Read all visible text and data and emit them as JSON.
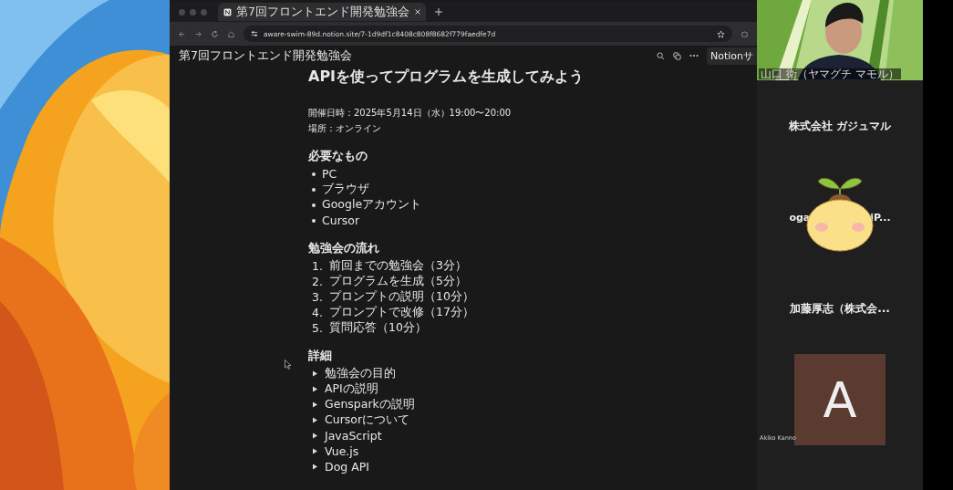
{
  "browser": {
    "tabs": [
      {
        "title": "第7回フロントエンド開発勉強会",
        "selected": true
      }
    ],
    "url": "aware-swim-89d.notion.site/7-1d9df1c8408c808f8682f779faedfe7d"
  },
  "notion": {
    "breadcrumb": "第7回フロントエンド開発勉強会",
    "share_button": "Notionサ",
    "title": "APIを使ってプログラムを生成してみよう",
    "info": [
      "開催日時：2025年5月14日（水）19:00〜20:00",
      "場所：オンライン"
    ],
    "sections": [
      {
        "heading": "必要なもの",
        "kind": "bullet",
        "items": [
          {
            "text": "PC"
          },
          {
            "text": "ブラウザ"
          },
          {
            "text": "Googleアカウント"
          },
          {
            "text": "Cursor"
          }
        ]
      },
      {
        "heading": "勉強会の流れ",
        "kind": "numbered",
        "items": [
          {
            "number": "1.",
            "text": "前回までの勉強会（3分）"
          },
          {
            "number": "2.",
            "text": "プログラムを生成（5分）"
          },
          {
            "number": "3.",
            "text": "プロンプトの説明（10分）"
          },
          {
            "number": "4.",
            "text": "プロンプトで改修（17分）"
          },
          {
            "number": "5.",
            "text": "質問応答（10分）"
          }
        ]
      },
      {
        "heading": "詳細",
        "kind": "toggle",
        "items": [
          {
            "text": "勉強会の目的"
          },
          {
            "text": "APIの説明"
          },
          {
            "text": "Gensparkの説明"
          },
          {
            "text": "Cursorについて"
          },
          {
            "text": "JavaScript"
          },
          {
            "text": "Vue.js"
          },
          {
            "text": "Dog API"
          }
        ]
      }
    ]
  },
  "meeting": {
    "video": {
      "name": "山口 衛（ヤマグチ マモル）",
      "kind": "picture"
    },
    "participants": [
      {
        "kind": "name",
        "name": "株式会社 ガジュマル"
      },
      {
        "kind": "covered",
        "name_start": "oga",
        "name_end": "iP..."
      },
      {
        "kind": "name",
        "name": "加藤厚志（株式会..."
      },
      {
        "kind": "initial",
        "initial": "A",
        "name": "Akiko Kanno",
        "color": "#5b3a2f"
      }
    ]
  }
}
